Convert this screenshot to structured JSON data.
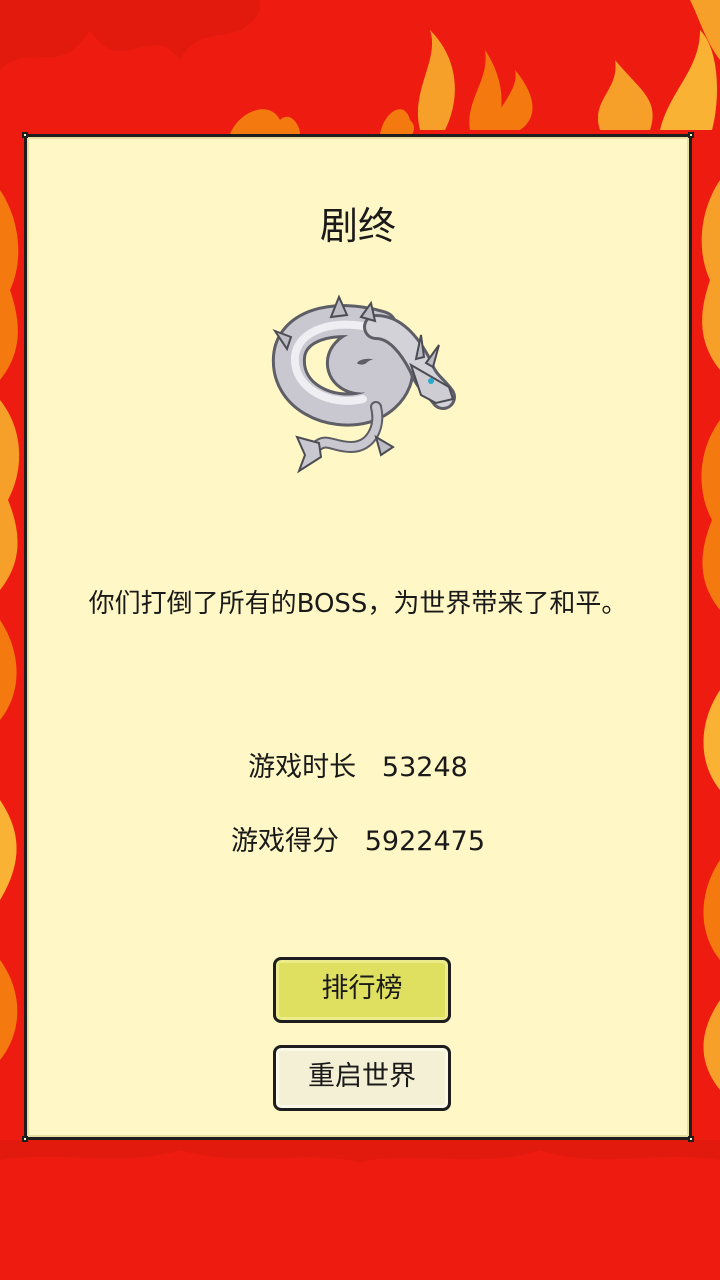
{
  "dialog": {
    "title": "剧终",
    "image_icon": "silver-dragon-boss",
    "message": "你们打倒了所有的BOSS，为世界带来了和平。",
    "stats": {
      "time_label": "游戏时长",
      "time_value": "53248",
      "score_label": "游戏得分",
      "score_value": "5922475"
    },
    "buttons": {
      "leaderboard": "排行榜",
      "restart": "重启世界"
    }
  },
  "colors": {
    "background": "#ee1c10",
    "flame_orange": "#f47a10",
    "flame_yellow": "#f9b233",
    "panel": "#fff8c6",
    "primary_button": "#dfe060",
    "secondary_button": "#f3f0d6"
  }
}
